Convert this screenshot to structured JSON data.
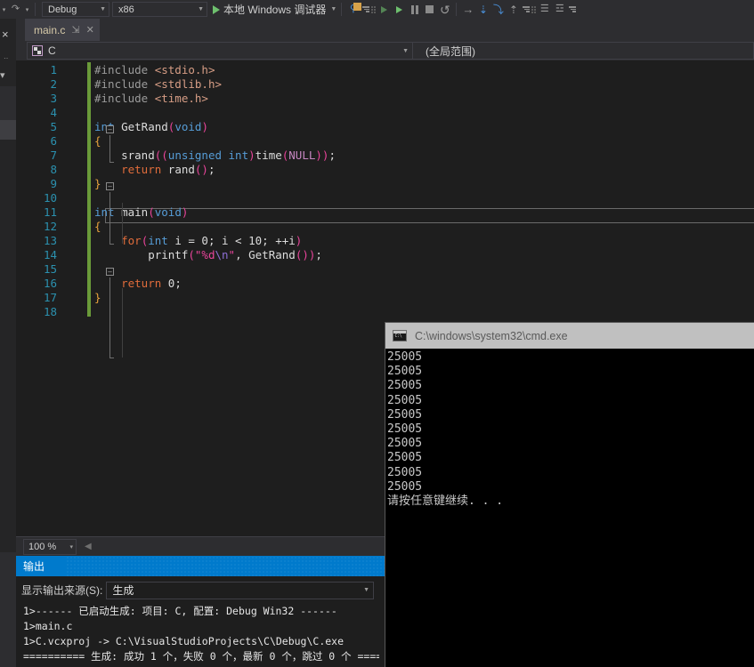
{
  "toolbar": {
    "undo_icon": "undo-icon",
    "redo_icon": "redo-icon",
    "configuration": {
      "value": "Debug",
      "caret": "▼"
    },
    "platform": {
      "value": "x86",
      "caret": "▼"
    },
    "run_label": "本地 Windows 调试器",
    "run_caret": "▼",
    "icons": [
      "attach-to-process-icon",
      "start-debug-icon",
      "start-without-debug-icon",
      "pause-icon",
      "stop-icon",
      "restart-icon",
      "show-next-statement-icon",
      "step-into-icon",
      "step-over-icon",
      "step-out-icon",
      "indent-icon",
      "outdent-icon",
      "comment-icon"
    ]
  },
  "left_strip": {
    "close_icon": "×",
    "dots_icon": "‥",
    "zoom_caret": "▾"
  },
  "tab": {
    "title": "main.c",
    "pin_icon": "⇲",
    "close_icon": "✕"
  },
  "navbar": {
    "project": "C",
    "project_caret": "▼",
    "scope": "(全局范围)",
    "scope_caret": "▼",
    "icon": "cs-file-icon"
  },
  "editor": {
    "line_numbers": [
      "1",
      "2",
      "3",
      "4",
      "5",
      "6",
      "7",
      "8",
      "9",
      "10",
      "11",
      "12",
      "13",
      "14",
      "15",
      "16",
      "17",
      "18"
    ],
    "current_line": 7,
    "lines": [
      {
        "n": 1,
        "tokens": [
          {
            "t": "#include ",
            "c": "t-pre"
          },
          {
            "t": "<stdio.h>",
            "c": "t-str"
          }
        ]
      },
      {
        "n": 2,
        "tokens": [
          {
            "t": "#include ",
            "c": "t-pre"
          },
          {
            "t": "<stdlib.h>",
            "c": "t-str"
          }
        ]
      },
      {
        "n": 3,
        "tokens": [
          {
            "t": "#include ",
            "c": "t-pre"
          },
          {
            "t": "<time.h>",
            "c": "t-str"
          }
        ]
      },
      {
        "n": 4,
        "tokens": []
      },
      {
        "n": 5,
        "tokens": [
          {
            "t": "int",
            "c": "t-key"
          },
          {
            "t": " GetRand",
            "c": "t-plain"
          },
          {
            "t": "(",
            "c": "t-par"
          },
          {
            "t": "void",
            "c": "t-key"
          },
          {
            "t": ")",
            "c": "t-par"
          }
        ]
      },
      {
        "n": 6,
        "tokens": [
          {
            "t": "{",
            "c": "t-brace"
          }
        ]
      },
      {
        "n": 7,
        "tokens": [
          {
            "t": "    srand",
            "c": "t-plain"
          },
          {
            "t": "((",
            "c": "t-par"
          },
          {
            "t": "unsigned int",
            "c": "t-key"
          },
          {
            "t": ")",
            "c": "t-par"
          },
          {
            "t": "time",
            "c": "t-plain"
          },
          {
            "t": "(",
            "c": "t-par"
          },
          {
            "t": "NULL",
            "c": "t-mac"
          },
          {
            "t": "))",
            "c": "t-par"
          },
          {
            "t": ";",
            "c": "t-plain"
          }
        ]
      },
      {
        "n": 8,
        "tokens": [
          {
            "t": "    ",
            "c": "t-plain"
          },
          {
            "t": "return",
            "c": "t-ctrl"
          },
          {
            "t": " rand",
            "c": "t-plain"
          },
          {
            "t": "()",
            "c": "t-par"
          },
          {
            "t": ";",
            "c": "t-plain"
          }
        ]
      },
      {
        "n": 9,
        "tokens": [
          {
            "t": "}",
            "c": "t-brace"
          }
        ]
      },
      {
        "n": 10,
        "tokens": []
      },
      {
        "n": 11,
        "tokens": [
          {
            "t": "int",
            "c": "t-key"
          },
          {
            "t": " main",
            "c": "t-plain"
          },
          {
            "t": "(",
            "c": "t-par"
          },
          {
            "t": "void",
            "c": "t-key"
          },
          {
            "t": ")",
            "c": "t-par"
          }
        ]
      },
      {
        "n": 12,
        "tokens": [
          {
            "t": "{",
            "c": "t-brace"
          }
        ]
      },
      {
        "n": 13,
        "tokens": [
          {
            "t": "    ",
            "c": "t-plain"
          },
          {
            "t": "for",
            "c": "t-ctrl"
          },
          {
            "t": "(",
            "c": "t-par"
          },
          {
            "t": "int",
            "c": "t-key"
          },
          {
            "t": " i = 0; i < 10; ++i",
            "c": "t-plain"
          },
          {
            "t": ")",
            "c": "t-par"
          }
        ]
      },
      {
        "n": 14,
        "tokens": [
          {
            "t": "        printf",
            "c": "t-plain"
          },
          {
            "t": "(",
            "c": "t-par"
          },
          {
            "t": "\"",
            "c": "t-fmt"
          },
          {
            "t": "%d",
            "c": "t-fmt"
          },
          {
            "t": "\\n",
            "c": "t-esc"
          },
          {
            "t": "\"",
            "c": "t-fmt"
          },
          {
            "t": ", GetRand",
            "c": "t-plain"
          },
          {
            "t": "())",
            "c": "t-par"
          },
          {
            "t": ";",
            "c": "t-plain"
          }
        ]
      },
      {
        "n": 15,
        "tokens": []
      },
      {
        "n": 16,
        "tokens": [
          {
            "t": "    ",
            "c": "t-plain"
          },
          {
            "t": "return",
            "c": "t-ctrl"
          },
          {
            "t": " 0;",
            "c": "t-plain"
          }
        ]
      },
      {
        "n": 17,
        "tokens": [
          {
            "t": "}",
            "c": "t-brace"
          }
        ]
      },
      {
        "n": 18,
        "tokens": []
      }
    ]
  },
  "zoombar": {
    "zoom_level": "100 %",
    "zoom_caret": "▾",
    "scroll_arrow": "◀"
  },
  "output_panel": {
    "tab_label": "输出",
    "source_label": "显示输出来源(S):",
    "source_value": "生成",
    "source_caret": "▼",
    "toolbar_icons": [
      "jump-to-message-icon",
      "prev-message-icon",
      "next-message-icon",
      "clear-all-icon",
      "word-wrap-icon"
    ],
    "lines": [
      "1>------ 已启动生成: 项目: C, 配置: Debug Win32 ------",
      "1>main.c",
      "1>C.vcxproj -> C:\\VisualStudioProjects\\C\\Debug\\C.exe",
      "========== 生成: 成功 1 个，失败 0 个，最新 0 个，跳过 0 个 =========="
    ]
  },
  "console_window": {
    "title": "C:\\windows\\system32\\cmd.exe",
    "icon": "cmd-icon",
    "lines": [
      "25005",
      "25005",
      "25005",
      "25005",
      "25005",
      "25005",
      "25005",
      "25005",
      "25005",
      "25005",
      "请按任意键继续. . ."
    ]
  },
  "colors": {
    "accent": "#007acc",
    "editor_bg": "#1e1e1e",
    "chrome_bg": "#2d2d30",
    "keyword": "#569cd6",
    "string": "#d69d85",
    "control": "#e06c3b",
    "macro": "#c586c0",
    "paren": "#e8449a",
    "change_bar": "#6a9a39",
    "console_title_bg": "#c0c0c0"
  }
}
